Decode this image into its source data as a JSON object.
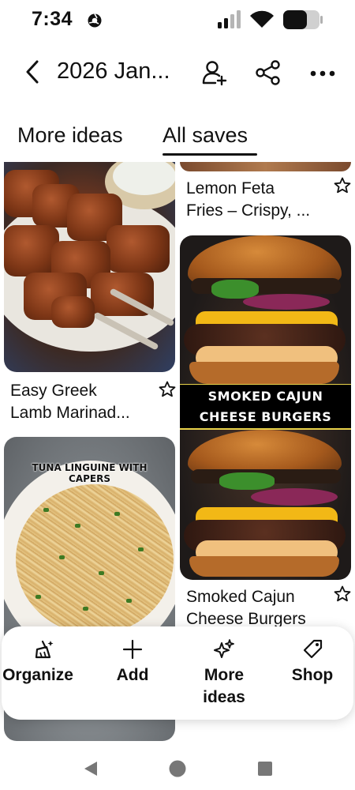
{
  "status_bar": {
    "time": "7:34",
    "icons": [
      "app-notification-icon",
      "cellular-signal-icon",
      "wifi-icon",
      "battery-icon"
    ]
  },
  "header": {
    "title": "2026 Jan...",
    "icons": [
      "back-arrow-icon",
      "add-collaborator-icon",
      "share-icon",
      "more-options-icon"
    ]
  },
  "tabs": [
    {
      "label": "More ideas",
      "selected": false
    },
    {
      "label": "All saves",
      "selected": true
    }
  ],
  "pins": {
    "left": [
      {
        "title_lines": [
          "Easy Greek",
          "Lamb Marinad..."
        ],
        "image": "grilled lamb skewers"
      },
      {
        "caption_lines": [
          "TUNA LINGUINE WITH",
          "CAPERS"
        ],
        "image": "tuna linguine pasta bowl"
      }
    ],
    "right": [
      {
        "title_lines": [
          "Lemon Feta",
          "Fries – Crispy, ..."
        ]
      },
      {
        "banner_lines": [
          "SMOKED CAJUN",
          "CHEESE BURGERS"
        ],
        "title_lines": [
          "Smoked Cajun",
          "Cheese Burgers"
        ],
        "image": "cheeseburger"
      }
    ]
  },
  "action_bar": {
    "items": [
      {
        "label": "Organize",
        "icon": "organize-broom-icon"
      },
      {
        "label": "Add",
        "icon": "plus-icon"
      },
      {
        "label_lines": [
          "More",
          "ideas"
        ],
        "icon": "sparkle-icon"
      },
      {
        "label": "Shop",
        "icon": "tag-icon"
      }
    ]
  },
  "nav_bar": {
    "icons": [
      "nav-back-icon",
      "nav-home-icon",
      "nav-recents-icon"
    ]
  }
}
